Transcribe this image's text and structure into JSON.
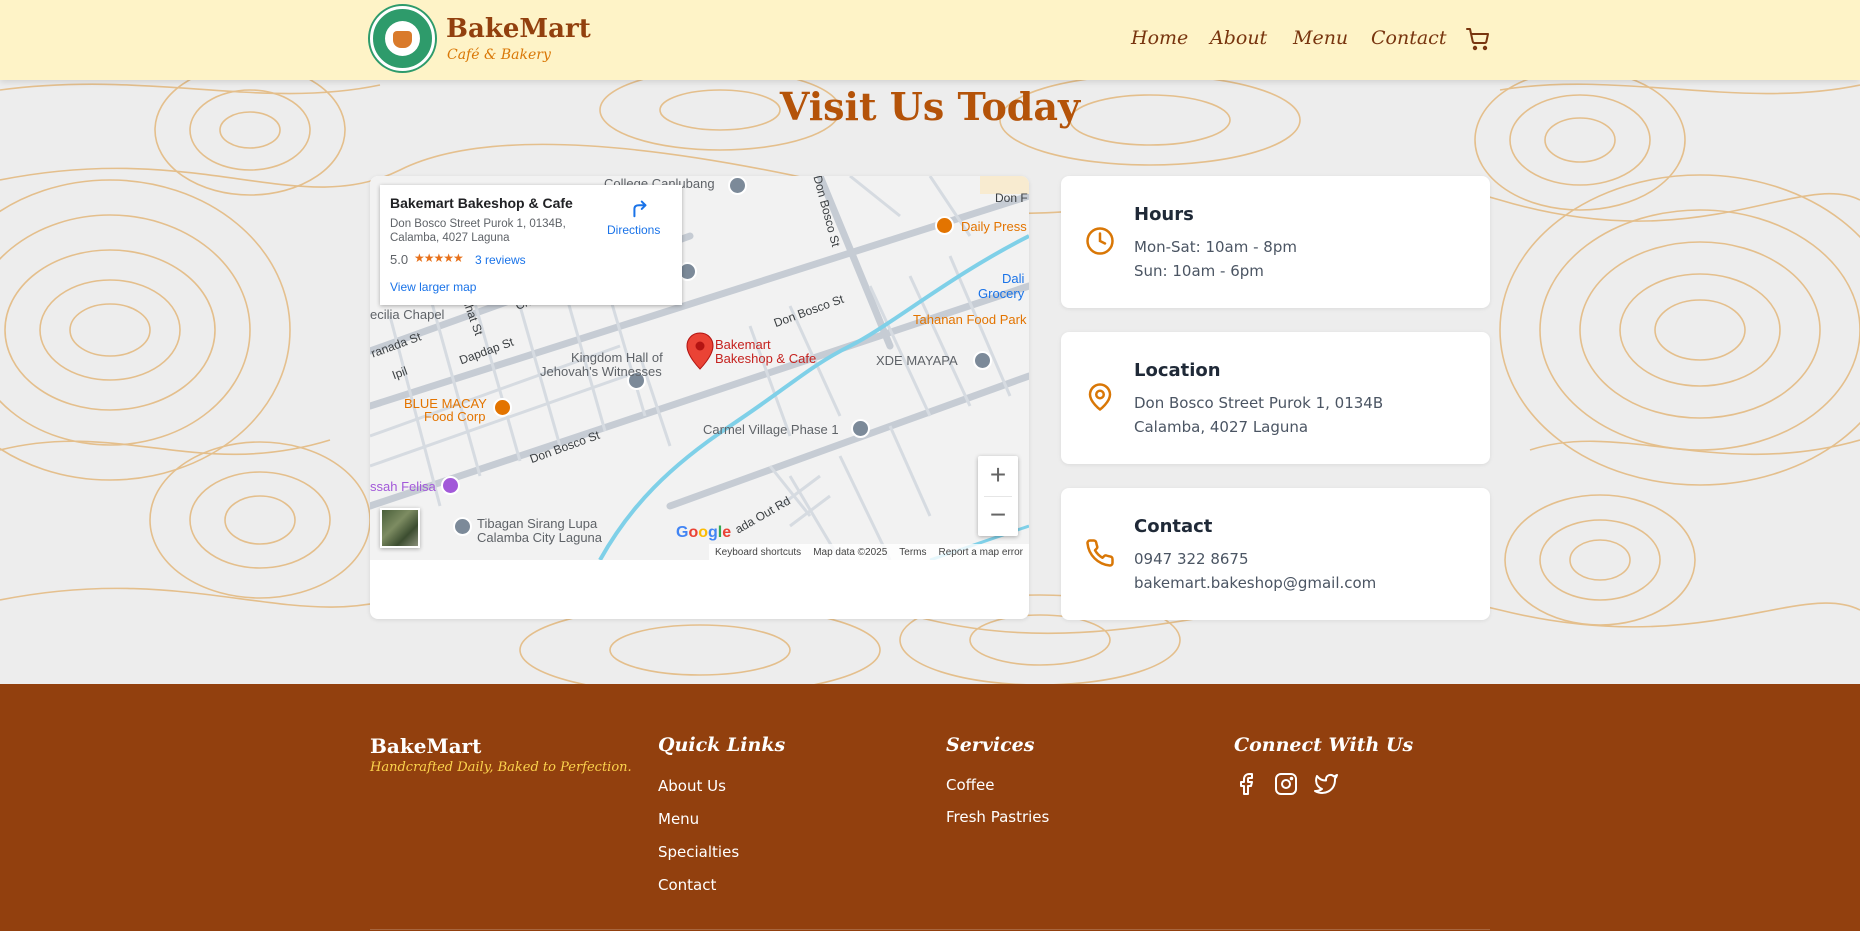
{
  "header": {
    "brand_name": "BakeMart",
    "brand_subtitle": "Café & Bakery",
    "logo_icon": "bakery-logo",
    "nav": [
      {
        "label": "Home"
      },
      {
        "label": "About"
      },
      {
        "label": "Menu"
      },
      {
        "label": "Contact"
      }
    ],
    "cart_icon": "shopping-cart-icon"
  },
  "main": {
    "title": "Visit Us Today",
    "map": {
      "place_name": "Bakemart Bakeshop & Cafe",
      "address_line1": "Don Bosco Street Purok 1, 0134B,",
      "address_line2": "Calamba, 4027 Laguna",
      "rating": "5.0",
      "stars": "★★★★★",
      "reviews": "3 reviews",
      "larger_map": "View larger map",
      "directions": "Directions",
      "pin_label_1": "Bakemart",
      "pin_label_2": "Bakeshop & Cafe",
      "labels": {
        "college": "College Canlubang",
        "daily_press": "Daily Press",
        "dali": "Dali",
        "grocery": "Grocery",
        "tahanan": "Tahanan Food Park",
        "cecilia": "ecilia Chapel",
        "granada": "ranada St",
        "duhat": "Duhat St",
        "chico": "Chico",
        "dapdap": "Dapdap St",
        "ipil": "Ipil",
        "kingdom1": "Kingdom Hall of",
        "kingdom2": "Jehovah's Witnesses",
        "xde": "XDE MAYAPA",
        "blue_macay1": "BLUE MACAY",
        "blue_macay2": "Food Corp",
        "don_bosco_1": "Don Bosco St",
        "don_bosco_2": "Don Bosco St",
        "don_bosco_3": "Don Bosco St",
        "don_top": "Don F",
        "carmel": "Carmel Village Phase 1",
        "felisa": "ssah Felisa",
        "tibagan1": "Tibagan Sirang Lupa",
        "tibagan2": "Calamba City Laguna",
        "out_rd": "ada Out Rd"
      },
      "google": "Google",
      "footer": [
        "Keyboard shortcuts",
        "Map data ©2025",
        "Terms",
        "Report a map error"
      ],
      "zoom_in": "+",
      "zoom_out": "−"
    },
    "cards": [
      {
        "icon": "clock-icon",
        "title": "Hours",
        "lines": [
          "Mon-Sat: 10am - 8pm",
          "Sun: 10am - 6pm"
        ]
      },
      {
        "icon": "location-pin-icon",
        "title": "Location",
        "lines": [
          "Don Bosco Street Purok 1, 0134B",
          "Calamba, 4027 Laguna"
        ]
      },
      {
        "icon": "phone-icon",
        "title": "Contact",
        "lines": [
          "0947 322 8675",
          "bakemart.bakeshop@gmail.com"
        ]
      }
    ]
  },
  "footer": {
    "brand": "BakeMart",
    "tagline": "Handcrafted Daily, Baked to Perfection.",
    "quick_links": {
      "heading": "Quick Links",
      "items": [
        "About Us",
        "Menu",
        "Specialties",
        "Contact"
      ]
    },
    "services": {
      "heading": "Services",
      "items": [
        "Coffee",
        "Fresh Pastries"
      ]
    },
    "connect": {
      "heading": "Connect With Us",
      "icons": [
        "facebook-icon",
        "instagram-icon",
        "twitter-icon"
      ]
    }
  },
  "colors": {
    "header_bg": "#fef3c7",
    "brand_brown": "#92400e",
    "accent_orange": "#d97706",
    "footer_bg": "#92400e",
    "topo_line": "#e5b878"
  }
}
